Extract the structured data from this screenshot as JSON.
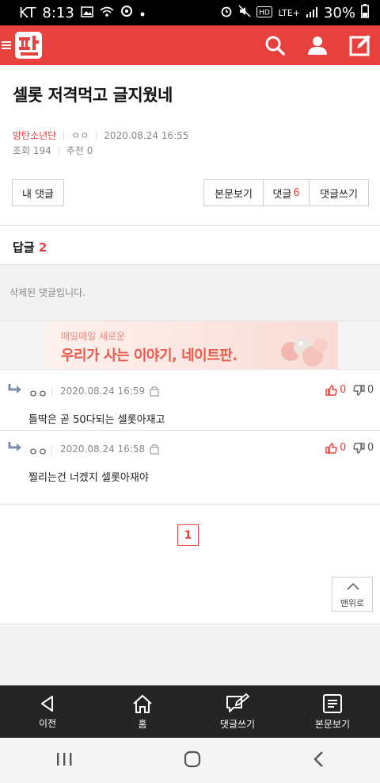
{
  "status_bar": {
    "carrier": "KT",
    "time": "8:13",
    "battery": "30%",
    "network": "LTE+"
  },
  "post": {
    "title": "셀롯 저격먹고 글지웠네",
    "author": "방탄소년단",
    "writer": "ㅇㅇ",
    "datetime": "2020.08.24 16:55",
    "views_label": "조회 194",
    "recommend_label": "추천 0"
  },
  "buttons": {
    "my_comments": "내 댓글",
    "view_body": "본문보기",
    "comments_label": "댓글",
    "comments_count": "6",
    "write_comment": "댓글쓰기"
  },
  "replies": {
    "label": "답글",
    "count": "2",
    "deleted_text": "삭제된 댓글입니다."
  },
  "banner": {
    "sub": "매일매일 새로운",
    "main": "우리가 사는 이야기, 네이트판."
  },
  "comments": [
    {
      "name": "ㅇㅇ",
      "date": "2020.08.24 16:59",
      "text": "틀딱은 곧 50다되는 셀롯아재고",
      "likes": "0",
      "dislikes": "0"
    },
    {
      "name": "ㅇㅇ",
      "date": "2020.08.24 16:58",
      "text": "찔리는건 너겠지 셀롯아재야",
      "likes": "0",
      "dislikes": "0"
    }
  ],
  "pagination": {
    "current": "1"
  },
  "to_top": "맨위로",
  "bottom_nav": [
    {
      "label": "이전",
      "icon": "back-triangle-icon"
    },
    {
      "label": "홈",
      "icon": "home-icon"
    },
    {
      "label": "댓글쓰기",
      "icon": "comment-write-icon"
    },
    {
      "label": "본문보기",
      "icon": "document-icon"
    }
  ],
  "colors": {
    "brand": "#e8403d",
    "bottom_bar": "#252525"
  }
}
